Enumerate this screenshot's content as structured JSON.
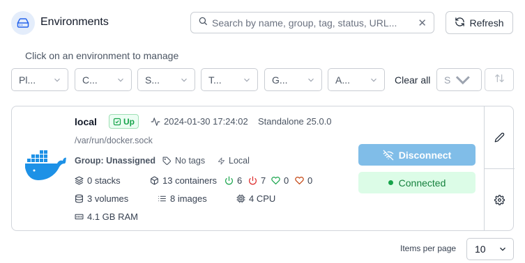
{
  "header": {
    "title": "Environments",
    "search_placeholder": "Search by name, group, tag, status, URL...",
    "refresh_label": "Refresh"
  },
  "subtitle": "Click on an environment to manage",
  "filters": [
    {
      "label": "Pl..."
    },
    {
      "label": "C..."
    },
    {
      "label": "S..."
    },
    {
      "label": "T..."
    },
    {
      "label": "G..."
    },
    {
      "label": "A..."
    }
  ],
  "clear_all_label": "Clear all",
  "sort_by_placeholder": "S",
  "environment": {
    "name": "local",
    "status": "Up",
    "last_check": "2024-01-30 17:24:02",
    "platform": "Standalone 25.0.0",
    "url": "/var/run/docker.sock",
    "group": "Group: Unassigned",
    "tags": "No tags",
    "type": "Local",
    "stacks": "0 stacks",
    "containers": "13 containers",
    "running": "6",
    "stopped": "7",
    "healthy": "0",
    "unhealthy": "0",
    "volumes": "3 volumes",
    "images": "8 images",
    "cpu": "4 CPU",
    "ram": "4.1 GB RAM",
    "disconnect_label": "Disconnect",
    "connected_label": "Connected"
  },
  "pagination": {
    "items_per_page_label": "Items per page",
    "items_per_page_value": "10"
  },
  "colors": {
    "accent_blue": "#80bde8",
    "success_green": "#16a34a",
    "danger_red": "#dc2626",
    "warning_orange": "#c2410c",
    "docker_blue": "#1d91e6"
  }
}
